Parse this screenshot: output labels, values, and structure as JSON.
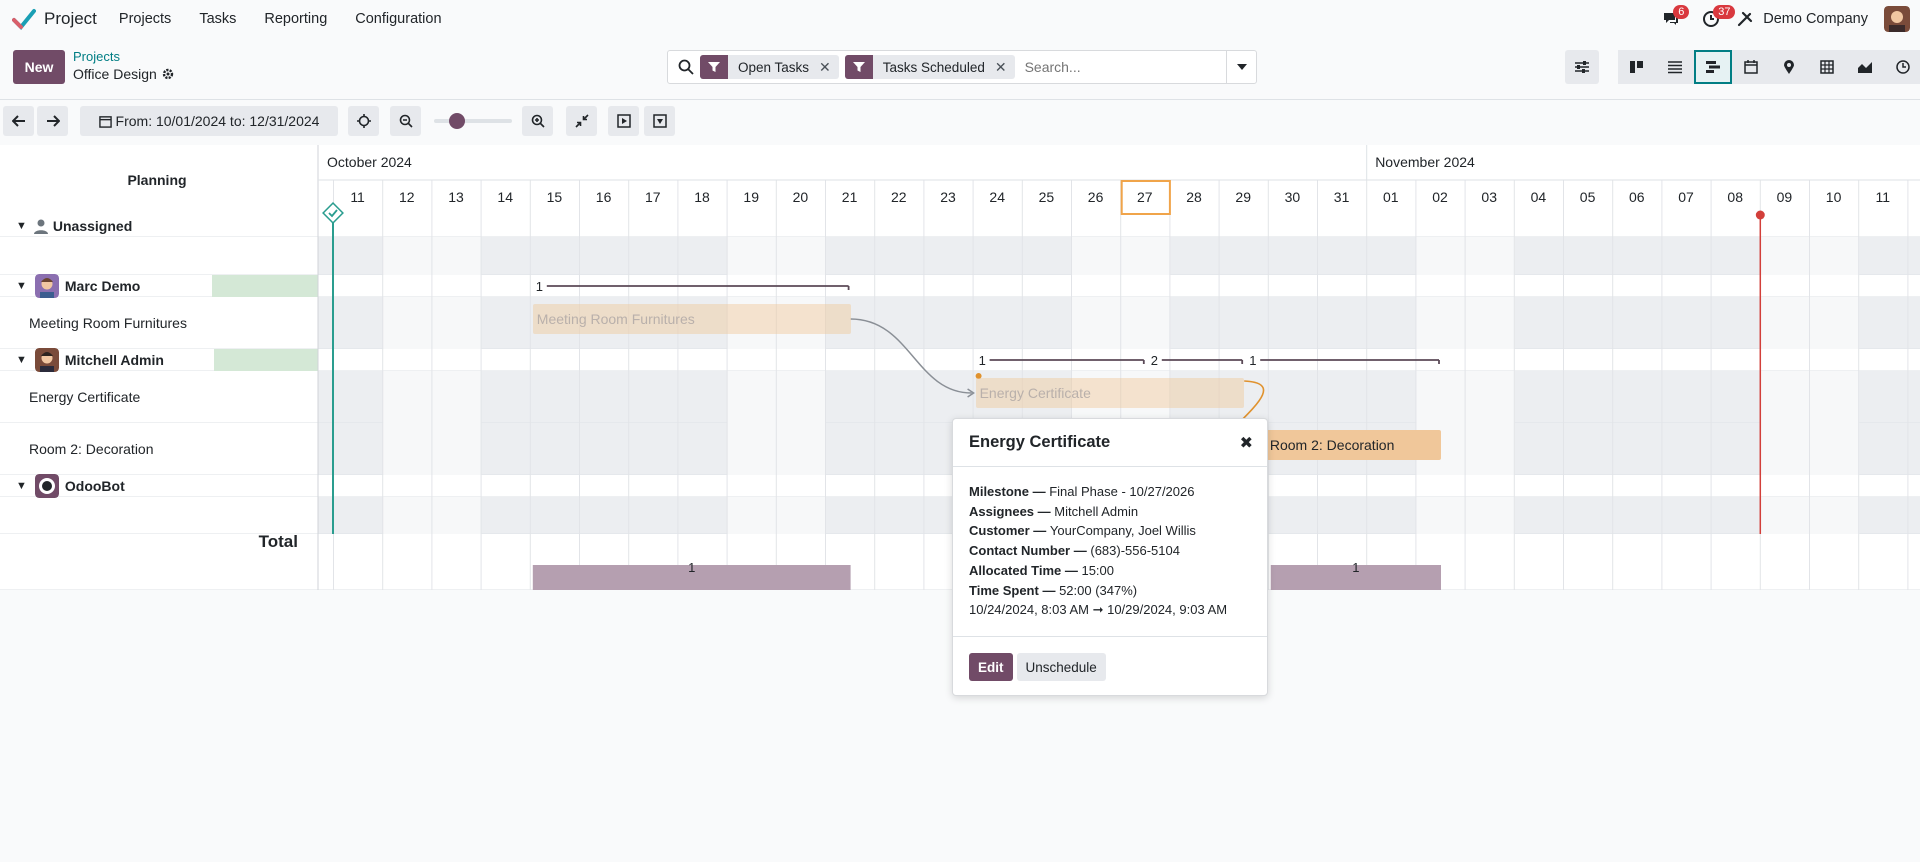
{
  "navbar": {
    "app_name": "Project",
    "menu": [
      "Projects",
      "Tasks",
      "Reporting",
      "Configuration"
    ],
    "messages_count": "6",
    "activities_count": "37",
    "company": "Demo Company"
  },
  "control": {
    "new_label": "New",
    "breadcrumb_parent": "Projects",
    "breadcrumb_current": "Office Design",
    "facets": [
      "Open Tasks",
      "Tasks Scheduled"
    ],
    "search_placeholder": "Search..."
  },
  "toolbar": {
    "date_range": "From: 10/01/2024 to: 12/31/2024",
    "zoom_level": 0.3
  },
  "gantt": {
    "planning_label": "Planning",
    "total_label": "Total",
    "months": [
      {
        "label": "October 2024",
        "start": 0
      },
      {
        "label": "November 2024",
        "start": 21
      }
    ],
    "days": [
      "11",
      "12",
      "13",
      "14",
      "15",
      "16",
      "17",
      "18",
      "19",
      "20",
      "21",
      "22",
      "23",
      "24",
      "25",
      "26",
      "27",
      "28",
      "29",
      "30",
      "31",
      "01",
      "02",
      "03",
      "04",
      "05",
      "06",
      "07",
      "08",
      "09",
      "10",
      "11"
    ],
    "today_index": 16,
    "rows": [
      {
        "label": "Unassigned",
        "type": "group"
      },
      {
        "label": "",
        "type": "task"
      },
      {
        "label": "Marc Demo",
        "type": "group"
      },
      {
        "label": "Meeting Room Furnitures",
        "type": "task"
      },
      {
        "label": "Mitchell Admin",
        "type": "group"
      },
      {
        "label": "Energy Certificate",
        "type": "task"
      },
      {
        "label": "Room 2: Decoration",
        "type": "task"
      },
      {
        "label": "OdooBot",
        "type": "group"
      }
    ],
    "pills": [
      {
        "name": "Meeting Room Furnitures",
        "start": 4,
        "end": 10.5,
        "row": 3
      },
      {
        "name": "Energy Certificate",
        "start": 13,
        "end": 18.5,
        "row": 5
      },
      {
        "name": "Room 2: Decoration",
        "start": 18.9,
        "end": 22.5,
        "row": 6
      }
    ],
    "group_counts": [
      {
        "value": "1",
        "start": 4,
        "end": 10.5,
        "row": 2
      },
      {
        "value": "1",
        "start": 13,
        "end": 16.5,
        "row": 4
      },
      {
        "value": "2",
        "start": 16.5,
        "end": 18.5,
        "row": 4
      },
      {
        "value": "1",
        "start": 18.5,
        "end": 22.5,
        "row": 4
      }
    ],
    "totals": [
      {
        "value": "1",
        "start": 4,
        "end": 10.5
      },
      {
        "value": "1",
        "start": 19,
        "end": 22.5
      }
    ]
  },
  "popover": {
    "title": "Energy Certificate",
    "fields": [
      {
        "label": "Milestone",
        "value": "Final Phase - 10/27/2026"
      },
      {
        "label": "Assignees",
        "value": "Mitchell Admin"
      },
      {
        "label": "Customer",
        "value": "YourCompany, Joel Willis"
      },
      {
        "label": "Contact Number",
        "value": "(683)-556-5104"
      },
      {
        "label": "Allocated Time",
        "value": "15:00"
      },
      {
        "label": "Time Spent",
        "value": "52:00 (347%)"
      }
    ],
    "dates": "10/24/2024, 8:03 AM ➞ 10/29/2024, 9:03 AM",
    "edit_label": "Edit",
    "unschedule_label": "Unschedule"
  },
  "colors": {
    "brand": "#714b67",
    "teal": "#017e84",
    "pill_orange": "#f0c79a",
    "total_bar": "#b59fb0",
    "today_line": "#d23f3a"
  }
}
